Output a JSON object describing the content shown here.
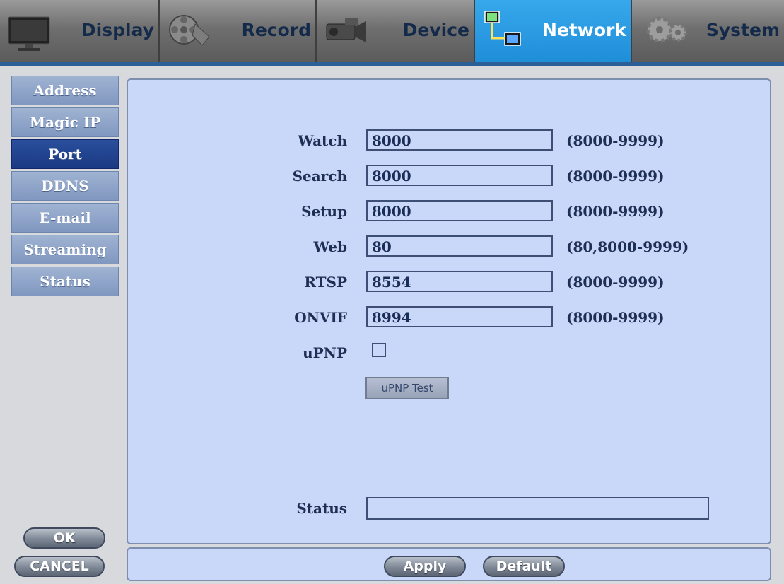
{
  "tabs": [
    {
      "label": "Display",
      "icon": "monitor-icon"
    },
    {
      "label": "Record",
      "icon": "film-reel-icon"
    },
    {
      "label": "Device",
      "icon": "camera-icon"
    },
    {
      "label": "Network",
      "icon": "network-icon",
      "active": true
    },
    {
      "label": "System",
      "icon": "gears-icon"
    }
  ],
  "sidebar": {
    "items": [
      "Address",
      "Magic IP",
      "Port",
      "DDNS",
      "E-mail",
      "Streaming",
      "Status"
    ],
    "active": "Port"
  },
  "ports": [
    {
      "label": "Watch",
      "value": "8000",
      "range": "(8000-9999)"
    },
    {
      "label": "Search",
      "value": "8000",
      "range": "(8000-9999)"
    },
    {
      "label": "Setup",
      "value": "8000",
      "range": "(8000-9999)"
    },
    {
      "label": "Web",
      "value": "80",
      "range": "(80,8000-9999)"
    },
    {
      "label": "RTSP",
      "value": "8554",
      "range": "(8000-9999)"
    },
    {
      "label": "ONVIF",
      "value": "8994",
      "range": "(8000-9999)"
    }
  ],
  "upnp": {
    "label": "uPNP",
    "checked": false,
    "test_button": "uPNP Test"
  },
  "status": {
    "label": "Status",
    "value": ""
  },
  "buttons": {
    "ok": "OK",
    "cancel": "CANCEL",
    "apply": "Apply",
    "default": "Default"
  },
  "colors": {
    "active_tab": "#1f8ed9",
    "active_side": "#1b3983",
    "panel_bg": "#c9d7f8"
  }
}
